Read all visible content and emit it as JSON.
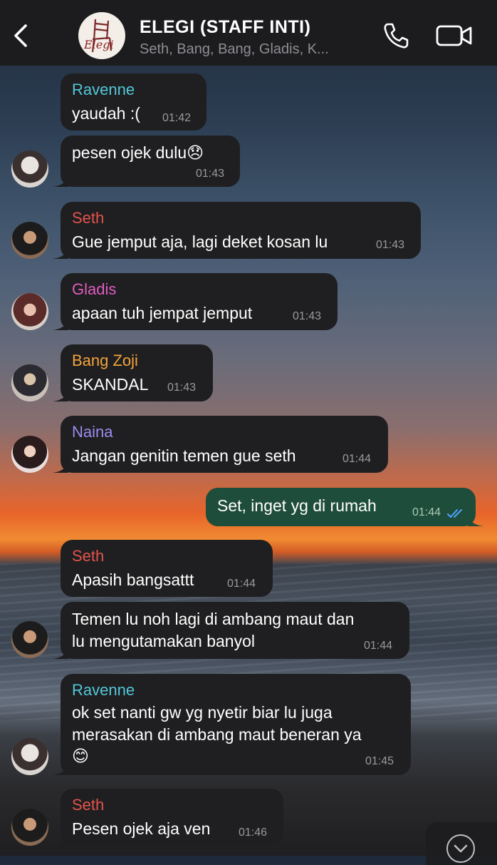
{
  "header": {
    "title": "ELEGI (STAFF INTI)",
    "members": "Seth, Bang, Bang, Gladis, K...",
    "logo_text": "Elegi"
  },
  "colors": {
    "bubble_in": "#1f1f21",
    "bubble_out": "#1f4d3b",
    "name_ravenne": "#52c7d8",
    "name_seth": "#e5534b",
    "name_gladis": "#e05cc0",
    "name_bangzoji": "#f3a33b",
    "name_naina": "#9b8cf0",
    "read_ticks": "#4fa3ff"
  },
  "messages": [
    {
      "sender": "Ravenne",
      "lines": [
        "yaudah :("
      ],
      "time": "01:42"
    },
    {
      "sender": "",
      "lines": [
        "pesen ojek dulu"
      ],
      "emoji": "😞",
      "time": "01:43"
    },
    {
      "sender": "Seth",
      "lines": [
        "Gue jemput aja, lagi deket kosan lu"
      ],
      "time": "01:43"
    },
    {
      "sender": "Gladis",
      "lines": [
        "apaan tuh jempat jemput"
      ],
      "time": "01:43"
    },
    {
      "sender": "Bang Zoji",
      "lines": [
        "SKANDAL"
      ],
      "time": "01:43"
    },
    {
      "sender": "Naina",
      "lines": [
        "Jangan genitin temen gue seth"
      ],
      "time": "01:44"
    },
    {
      "sender": "me",
      "lines": [
        "Set, inget yg di rumah"
      ],
      "time": "01:44",
      "status": "read"
    },
    {
      "sender": "Seth",
      "lines": [
        "Apasih bangsattt"
      ],
      "time": "01:44"
    },
    {
      "sender": "",
      "lines": [
        "Temen lu noh lagi di ambang maut dan",
        "lu mengutamakan banyol"
      ],
      "time": "01:44"
    },
    {
      "sender": "Ravenne",
      "lines": [
        "ok set nanti gw yg nyetir biar lu juga",
        "merasakan di ambang maut beneran ya"
      ],
      "emoji": "😊",
      "time": "01:45"
    },
    {
      "sender": "Seth",
      "lines": [
        "Pesen ojek aja ven"
      ],
      "time": "01:46"
    }
  ]
}
